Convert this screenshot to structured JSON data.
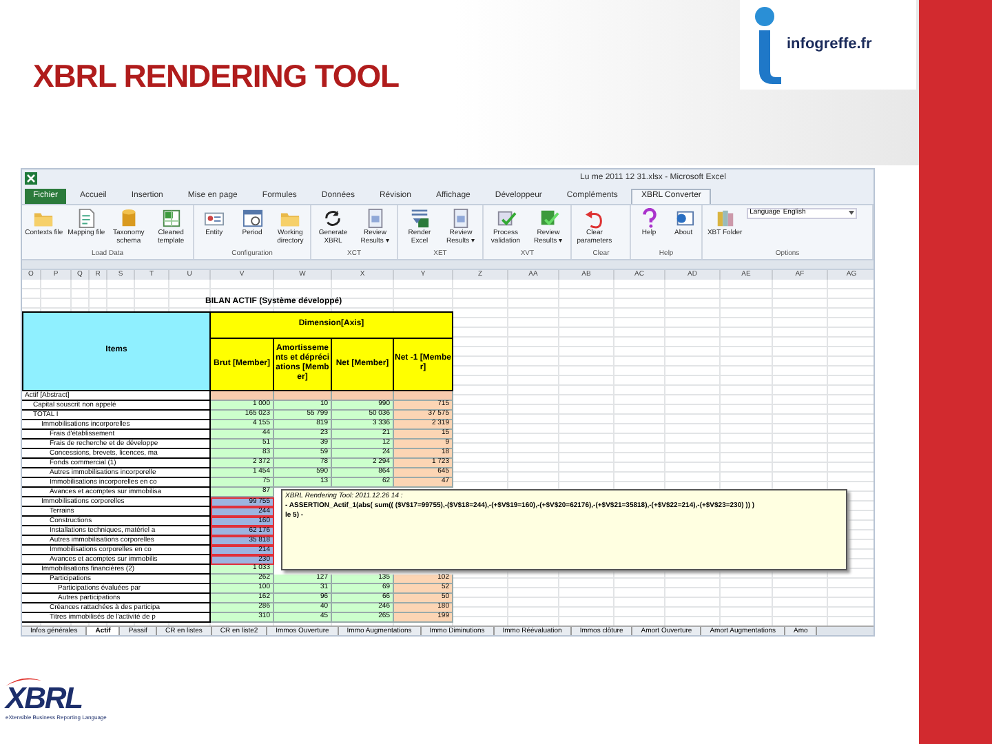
{
  "slide": {
    "title": "XBRL RENDERING TOOL"
  },
  "logo": {
    "text": "infogreffe.fr"
  },
  "excel": {
    "title": "Lu me 2011 12 31.xlsx - Microsoft Excel",
    "tabs": [
      {
        "label": "Fichier",
        "kind": "file",
        "selected": false
      },
      {
        "label": "Accueil",
        "kind": "tab",
        "selected": false
      },
      {
        "label": "Insertion",
        "kind": "tab",
        "selected": false
      },
      {
        "label": "Mise en page",
        "kind": "tab",
        "selected": false
      },
      {
        "label": "Formules",
        "kind": "tab",
        "selected": false
      },
      {
        "label": "Données",
        "kind": "tab",
        "selected": false
      },
      {
        "label": "Révision",
        "kind": "tab",
        "selected": false
      },
      {
        "label": "Affichage",
        "kind": "tab",
        "selected": false
      },
      {
        "label": "Développeur",
        "kind": "tab",
        "selected": false
      },
      {
        "label": "Compléments",
        "kind": "tab",
        "selected": false
      },
      {
        "label": "XBRL Converter",
        "kind": "tab",
        "selected": true
      }
    ],
    "groups": [
      {
        "label": "Load Data",
        "buttons": [
          {
            "label": "Contexts file",
            "kind": "folder"
          },
          {
            "label": "Mapping file",
            "kind": "document"
          },
          {
            "label": "Taxonomy schema",
            "kind": "cylinder"
          },
          {
            "label": "Cleaned template",
            "kind": "sheet"
          }
        ]
      },
      {
        "label": "Configuration",
        "buttons": [
          {
            "label": "Entity",
            "kind": "card"
          },
          {
            "label": "Period",
            "kind": "calendar"
          },
          {
            "label": "Working directory",
            "kind": "folder"
          }
        ]
      },
      {
        "label": "XCT",
        "buttons": [
          {
            "label": "Generate XBRL",
            "kind": "refresh"
          },
          {
            "label": "Review Results ▾",
            "kind": "report"
          }
        ]
      },
      {
        "label": "XET",
        "buttons": [
          {
            "label": "Render Excel",
            "kind": "render"
          },
          {
            "label": "Review Results ▾",
            "kind": "report"
          }
        ]
      },
      {
        "label": "XVT",
        "buttons": [
          {
            "label": "Process validation",
            "kind": "check"
          },
          {
            "label": "Review Results ▾",
            "kind": "sheetcheck"
          }
        ]
      },
      {
        "label": "Clear",
        "buttons": [
          {
            "label": "Clear parameters",
            "kind": "undo"
          }
        ]
      },
      {
        "label": "Help",
        "buttons": [
          {
            "label": "Help",
            "kind": "question"
          },
          {
            "label": "About",
            "kind": "info"
          }
        ]
      },
      {
        "label": "Options",
        "buttons": [
          {
            "label": "XBT Folder",
            "kind": "books"
          }
        ]
      }
    ],
    "language": {
      "label": "Language",
      "value": "English"
    },
    "columns": [
      "O",
      "P",
      "Q",
      "R",
      "S",
      "T",
      "U",
      "V",
      "W",
      "X",
      "Y",
      "Z",
      "AA",
      "AB",
      "AC",
      "AD",
      "AE",
      "AF",
      "AG"
    ],
    "sheet_title": "BILAN ACTIF (Système développé)",
    "table": {
      "items_heading": "Items",
      "axis": "Dimension[Axis]",
      "members": [
        "Brut [Member]",
        "Amortissements et dépréciations [Member]",
        "Net [Member]",
        "Net -1 [Member]"
      ],
      "rows": [
        {
          "label": "Actif [Abstract]",
          "kind": "abstract",
          "flagged": false,
          "children": [
            {
              "label": "Capital souscrit non appelé",
              "kind": "data",
              "flagged": false,
              "values": [
                "1 000",
                "10",
                "990",
                "715"
              ]
            },
            {
              "label": "TOTAL I",
              "kind": "data",
              "flagged": false,
              "values": [
                "165 023",
                "55 799",
                "50 036",
                "37 575"
              ],
              "children": [
                {
                  "label": "Immobilisations incorporelles",
                  "kind": "data",
                  "flagged": false,
                  "values": [
                    "4 155",
                    "819",
                    "3 336",
                    "2 319"
                  ],
                  "children": [
                    {
                      "label": "Frais d'établissement",
                      "kind": "data",
                      "flagged": false,
                      "values": [
                        "44",
                        "23",
                        "21",
                        "15"
                      ]
                    },
                    {
                      "label": "Frais de recherche et de développe",
                      "kind": "data",
                      "flagged": false,
                      "values": [
                        "51",
                        "39",
                        "12",
                        "9"
                      ]
                    },
                    {
                      "label": "Concessions, brevets, licences, ma",
                      "kind": "data",
                      "flagged": false,
                      "values": [
                        "83",
                        "59",
                        "24",
                        "18"
                      ]
                    },
                    {
                      "label": "Fonds commercial (1)",
                      "kind": "data",
                      "flagged": false,
                      "values": [
                        "2 372",
                        "78",
                        "2 294",
                        "1 723"
                      ]
                    },
                    {
                      "label": "Autres immobilisations incorporelle",
                      "kind": "data",
                      "flagged": false,
                      "values": [
                        "1 454",
                        "590",
                        "864",
                        "645"
                      ]
                    },
                    {
                      "label": "Immobilisations incorporelles en co",
                      "kind": "data",
                      "flagged": false,
                      "values": [
                        "75",
                        "13",
                        "62",
                        "47"
                      ]
                    },
                    {
                      "label": "Avances et acomptes sur immobilisa",
                      "kind": "data",
                      "flagged": false,
                      "values": [
                        "87"
                      ]
                    }
                  ]
                },
                {
                  "label": "Immobilisations corporelles",
                  "kind": "data",
                  "flagged": true,
                  "values": [
                    "99 755"
                  ],
                  "children": [
                    {
                      "label": "Terrains",
                      "kind": "data",
                      "flagged": true,
                      "values": [
                        "244"
                      ]
                    },
                    {
                      "label": "Constructions",
                      "kind": "data",
                      "flagged": true,
                      "values": [
                        "160"
                      ]
                    },
                    {
                      "label": "Installations techniques, matériel a",
                      "kind": "data",
                      "flagged": true,
                      "values": [
                        "62 176"
                      ]
                    },
                    {
                      "label": "Autres immobilisations corporelles",
                      "kind": "data",
                      "flagged": true,
                      "values": [
                        "35 818"
                      ]
                    },
                    {
                      "label": "Immobilisations corporelles en co",
                      "kind": "data",
                      "flagged": true,
                      "values": [
                        "214"
                      ]
                    },
                    {
                      "label": "Avances et acomptes sur immobilis",
                      "kind": "data",
                      "flagged": true,
                      "values": [
                        "230"
                      ]
                    }
                  ]
                },
                {
                  "label": "Immobilisations financières (2)",
                  "kind": "data",
                  "flagged": false,
                  "values": [
                    "1 033"
                  ],
                  "children": [
                    {
                      "label": "Participations",
                      "kind": "data",
                      "flagged": false,
                      "values": [
                        "262",
                        "127",
                        "135",
                        "102"
                      ],
                      "children": [
                        {
                          "label": "Participations évaluées par",
                          "kind": "data",
                          "flagged": false,
                          "values": [
                            "100",
                            "31",
                            "69",
                            "52"
                          ]
                        },
                        {
                          "label": "Autres participations",
                          "kind": "data",
                          "flagged": false,
                          "values": [
                            "162",
                            "96",
                            "66",
                            "50"
                          ]
                        }
                      ]
                    },
                    {
                      "label": "Créances rattachées à des participa",
                      "kind": "data",
                      "flagged": false,
                      "values": [
                        "286",
                        "40",
                        "246",
                        "180"
                      ]
                    },
                    {
                      "label": "Titres immobilisés de l'activité de p",
                      "kind": "data",
                      "flagged": false,
                      "values": [
                        "310",
                        "45",
                        "265",
                        "199"
                      ]
                    }
                  ]
                }
              ]
            }
          ]
        }
      ]
    },
    "tooltip": {
      "title": "XBRL Rendering Tool: 2011.12.26 14 :",
      "lines": [
        "- ASSERTION_Actif_1(abs( sum(( ($V$17=99755),-($V$18=244),-(+$V$19=160),-(+$V$20=62176),-(+$V$21=35818),-(+$V$22=214),-(+$V$23=230) )) )",
        "le 5) -"
      ]
    },
    "sheet_tabs": [
      {
        "label": "Infos générales",
        "selected": false
      },
      {
        "label": "Actif",
        "selected": true
      },
      {
        "label": "Passif",
        "selected": false
      },
      {
        "label": "CR en listes",
        "selected": false
      },
      {
        "label": "CR en liste2",
        "selected": false
      },
      {
        "label": "Immos Ouverture",
        "selected": false
      },
      {
        "label": "Immo Augmentations",
        "selected": false
      },
      {
        "label": "Immo Diminutions",
        "selected": false
      },
      {
        "label": "Immo Réévaluation",
        "selected": false
      },
      {
        "label": "Immos clôture",
        "selected": false
      },
      {
        "label": "Amort Ouverture",
        "selected": false
      },
      {
        "label": "Amort Augmentations",
        "selected": false
      },
      {
        "label": "Amo",
        "selected": false
      }
    ]
  },
  "footer_logo": {
    "text": "XBRL",
    "tagline": "eXtensible Business Reporting Language"
  }
}
